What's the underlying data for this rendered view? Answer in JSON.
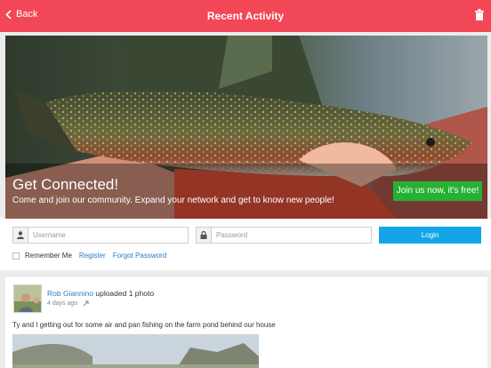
{
  "header": {
    "back_label": "Back",
    "title": "Recent Activity"
  },
  "hero": {
    "heading": "Get Connected!",
    "subtext": "Come and join our community. Expand your network and get to know new people!",
    "join_label": "Join us now, it's free!"
  },
  "login": {
    "username_placeholder": "Username",
    "password_placeholder": "Password",
    "login_label": "Login",
    "remember_label": "Remember Me",
    "register_label": "Register",
    "forgot_label": "Forgot Password"
  },
  "post": {
    "author": "Rob Giannino",
    "action": "uploaded 1 photo",
    "time": "4 days ago",
    "text": "Ty and I getting out for some air and pan fishing on the farm pond behind our house"
  },
  "colors": {
    "header": "#f24756",
    "join_button": "#25b233",
    "login_button": "#12a6e8",
    "link": "#2a7cc7"
  }
}
